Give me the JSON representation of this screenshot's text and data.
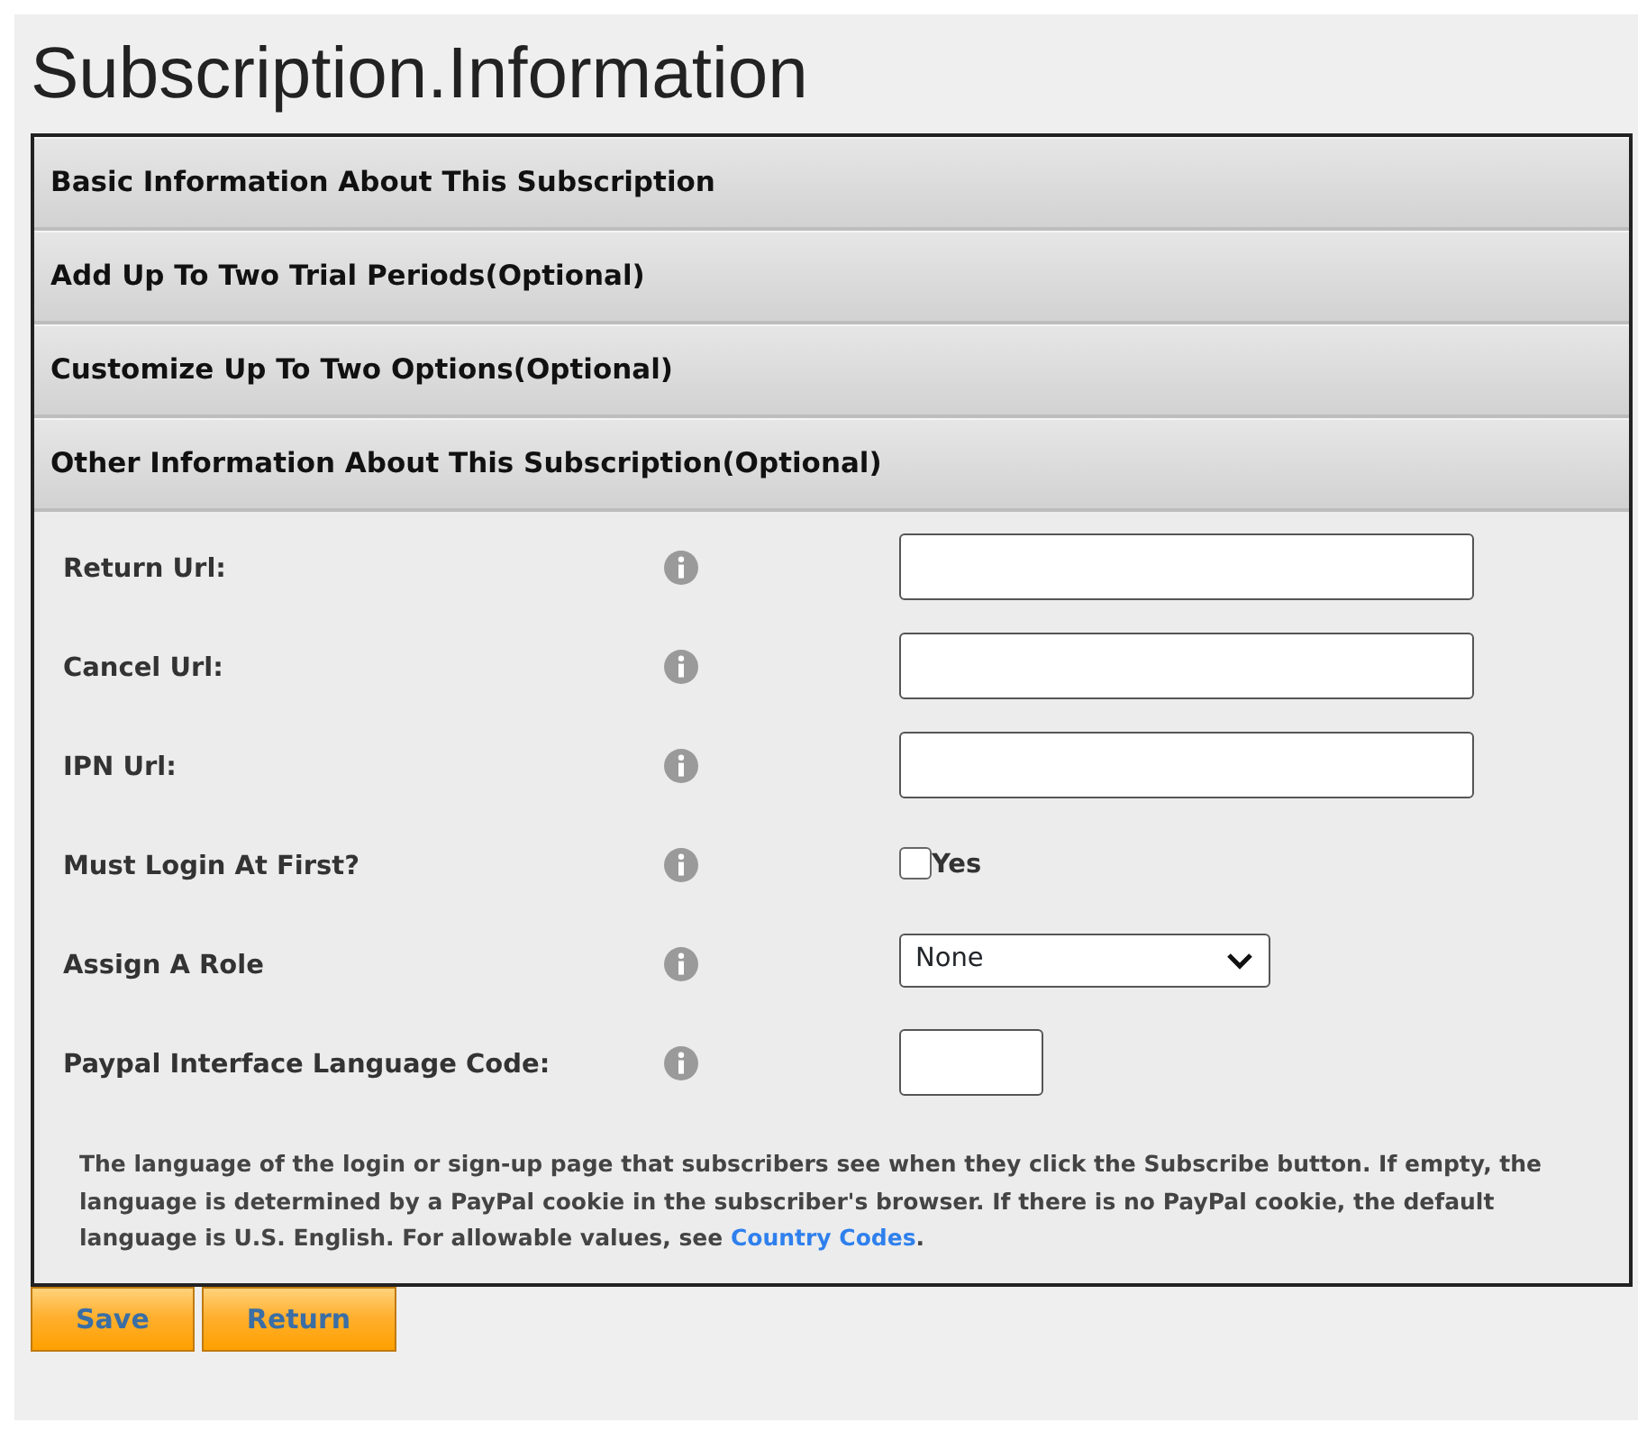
{
  "title": "Subscription.Information",
  "sections": [
    {
      "label": "Basic Information About This Subscription"
    },
    {
      "label": "Add Up To Two Trial Periods(Optional)"
    },
    {
      "label": "Customize Up To Two Options(Optional)"
    },
    {
      "label": "Other Information About This Subscription(Optional)"
    }
  ],
  "fields": [
    {
      "label": "Return Url:",
      "kind": "text"
    },
    {
      "label": "Cancel Url:",
      "kind": "text"
    },
    {
      "label": "IPN Url:",
      "kind": "text"
    },
    {
      "label": "Must Login At First?",
      "kind": "checkbox",
      "option": "Yes",
      "checked": false
    },
    {
      "label": "Assign A Role",
      "kind": "select",
      "value": "None"
    },
    {
      "label": "Paypal Interface Language Code:",
      "kind": "short"
    }
  ],
  "note": {
    "text": "The language of the login or sign-up page that subscribers see when they click the Subscribe button. If empty, the language is determined by a PayPal cookie in the subscriber's browser. If there is no PayPal cookie, the default language is U.S. English. For allowable values, see ",
    "link": "Country Codes",
    "after": "."
  },
  "buttons": [
    "Save",
    "Return"
  ]
}
